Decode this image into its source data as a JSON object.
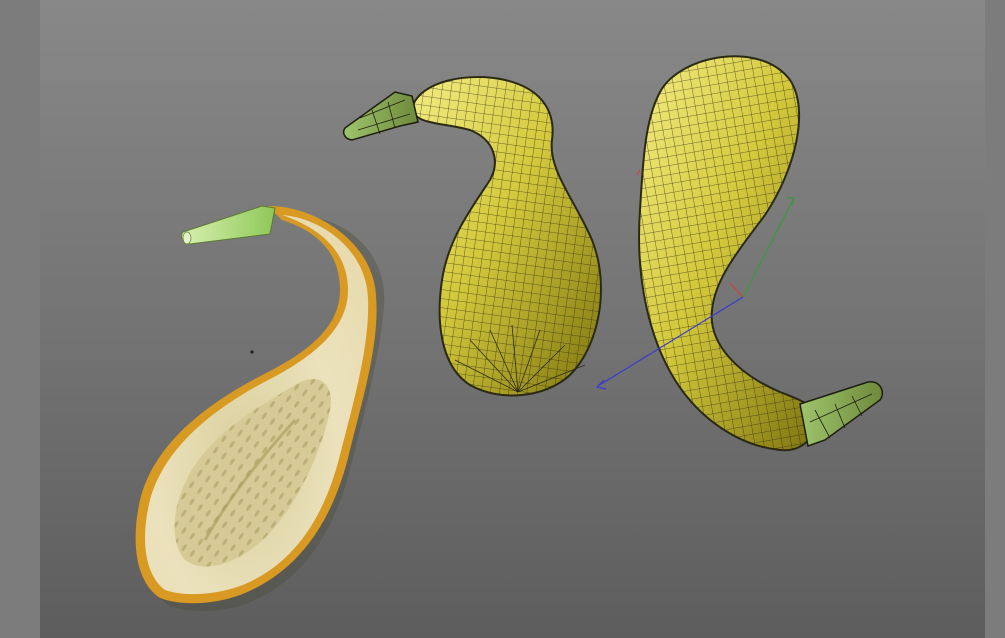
{
  "viewport": {
    "background_top": "#888888",
    "background_bottom": "#5d5d5d",
    "frame_color": "#7b7b7b"
  },
  "objects": [
    {
      "name": "sliced-squash-textured",
      "kind": "textured-cross-section",
      "colors": {
        "flesh": "#e6dcb0",
        "rind": "#d89a22",
        "stem": "#b8e08a",
        "seeds": "#b3a76a"
      }
    },
    {
      "name": "squash-wireframe-middle",
      "kind": "wireframe-mesh",
      "colors": {
        "fill": "#cfc43a",
        "wire": "#2a2a14"
      }
    },
    {
      "name": "squash-wireframe-right",
      "kind": "wireframe-mesh",
      "colors": {
        "fill": "#cfc43a",
        "wire": "#2a2a14"
      }
    }
  ],
  "gizmo": {
    "axes": [
      {
        "name": "x-axis",
        "color": "#d04040"
      },
      {
        "name": "y-axis",
        "color": "#3a9a3a"
      },
      {
        "name": "z-axis",
        "color": "#3a3ad0"
      }
    ]
  }
}
